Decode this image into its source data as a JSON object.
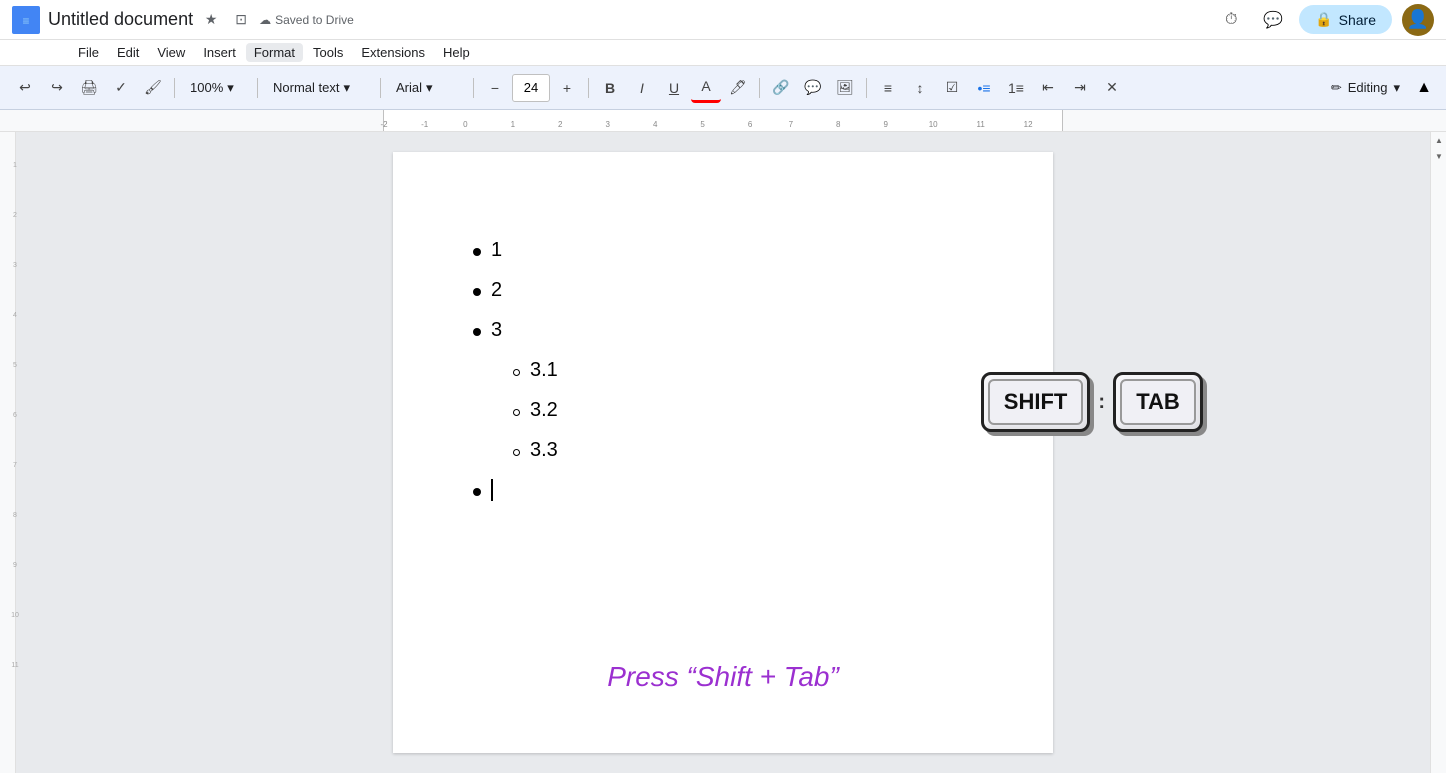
{
  "titleBar": {
    "docTitle": "Untitled document",
    "savedStatus": "Saved to Drive",
    "shareLabel": "Share"
  },
  "menuBar": {
    "items": [
      "File",
      "Edit",
      "View",
      "Insert",
      "Format",
      "Tools",
      "Extensions",
      "Help"
    ]
  },
  "toolbar": {
    "undoLabel": "↩",
    "redoLabel": "↪",
    "printLabel": "🖨",
    "paintLabel": "✏",
    "zoomValue": "100%",
    "styleValue": "Normal text",
    "fontValue": "Arial",
    "fontSize": "24",
    "boldLabel": "B",
    "italicLabel": "I",
    "underlineLabel": "U",
    "editingMode": "Editing"
  },
  "document": {
    "bulletItems": [
      {
        "level": 1,
        "text": "1"
      },
      {
        "level": 1,
        "text": "2"
      },
      {
        "level": 1,
        "text": "3"
      },
      {
        "level": 2,
        "text": "3.1"
      },
      {
        "level": 2,
        "text": "3.2"
      },
      {
        "level": 2,
        "text": "3.3"
      },
      {
        "level": 1,
        "text": "",
        "cursor": true
      }
    ],
    "keyboardShift": "SHIFT",
    "keyboardTab": "TAB",
    "keyboardPlus": ":",
    "pressText": "Press “Shift + Tab”"
  }
}
